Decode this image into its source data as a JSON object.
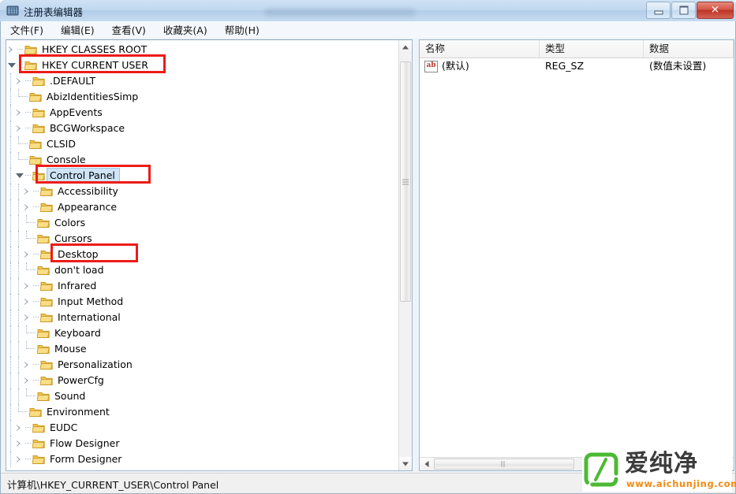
{
  "window": {
    "title": "注册表编辑器",
    "icon": "registry-editor-icon",
    "controls": {
      "minimize": "–",
      "maximize": "□",
      "close": "✕"
    }
  },
  "menubar": {
    "items": [
      {
        "label": "文件(F)",
        "name": "menu-file"
      },
      {
        "label": "编辑(E)",
        "name": "menu-edit"
      },
      {
        "label": "查看(V)",
        "name": "menu-view"
      },
      {
        "label": "收藏夹(A)",
        "name": "menu-favorites"
      },
      {
        "label": "帮助(H)",
        "name": "menu-help"
      }
    ]
  },
  "tree": {
    "items": [
      {
        "label": "HKEY CLASSES ROOT",
        "depth": 0,
        "state": "collapsed",
        "selected": false,
        "highlight": false
      },
      {
        "label": "HKEY CURRENT USER",
        "depth": 0,
        "state": "expanded",
        "selected": false,
        "highlight": true
      },
      {
        "label": ".DEFAULT",
        "depth": 1,
        "state": "collapsed",
        "selected": false,
        "highlight": false
      },
      {
        "label": "AbizIdentitiesSimp",
        "depth": 1,
        "state": "leaf",
        "selected": false,
        "highlight": false
      },
      {
        "label": "AppEvents",
        "depth": 1,
        "state": "collapsed",
        "selected": false,
        "highlight": false
      },
      {
        "label": "BCGWorkspace",
        "depth": 1,
        "state": "collapsed",
        "selected": false,
        "highlight": false
      },
      {
        "label": "CLSID",
        "depth": 1,
        "state": "leaf",
        "selected": false,
        "highlight": false
      },
      {
        "label": "Console",
        "depth": 1,
        "state": "leaf",
        "selected": false,
        "highlight": false
      },
      {
        "label": "Control Panel",
        "depth": 1,
        "state": "expanded",
        "selected": true,
        "highlight": true
      },
      {
        "label": "Accessibility",
        "depth": 2,
        "state": "collapsed",
        "selected": false,
        "highlight": false
      },
      {
        "label": "Appearance",
        "depth": 2,
        "state": "collapsed",
        "selected": false,
        "highlight": false
      },
      {
        "label": "Colors",
        "depth": 2,
        "state": "leaf",
        "selected": false,
        "highlight": false
      },
      {
        "label": "Cursors",
        "depth": 2,
        "state": "leaf",
        "selected": false,
        "highlight": false
      },
      {
        "label": "Desktop",
        "depth": 2,
        "state": "collapsed",
        "selected": false,
        "highlight": true
      },
      {
        "label": "don't load",
        "depth": 2,
        "state": "leaf",
        "selected": false,
        "highlight": false
      },
      {
        "label": "Infrared",
        "depth": 2,
        "state": "collapsed",
        "selected": false,
        "highlight": false
      },
      {
        "label": "Input Method",
        "depth": 2,
        "state": "collapsed",
        "selected": false,
        "highlight": false
      },
      {
        "label": "International",
        "depth": 2,
        "state": "collapsed",
        "selected": false,
        "highlight": false
      },
      {
        "label": "Keyboard",
        "depth": 2,
        "state": "leaf",
        "selected": false,
        "highlight": false
      },
      {
        "label": "Mouse",
        "depth": 2,
        "state": "leaf",
        "selected": false,
        "highlight": false
      },
      {
        "label": "Personalization",
        "depth": 2,
        "state": "collapsed",
        "selected": false,
        "highlight": false
      },
      {
        "label": "PowerCfg",
        "depth": 2,
        "state": "collapsed",
        "selected": false,
        "highlight": false
      },
      {
        "label": "Sound",
        "depth": 2,
        "state": "leaf",
        "selected": false,
        "highlight": false
      },
      {
        "label": "Environment",
        "depth": 1,
        "state": "leaf",
        "selected": false,
        "highlight": false
      },
      {
        "label": "EUDC",
        "depth": 1,
        "state": "collapsed",
        "selected": false,
        "highlight": false
      },
      {
        "label": "Flow Designer",
        "depth": 1,
        "state": "collapsed",
        "selected": false,
        "highlight": false
      },
      {
        "label": "Form Designer",
        "depth": 1,
        "state": "collapsed",
        "selected": false,
        "highlight": false
      }
    ]
  },
  "values": {
    "columns": [
      {
        "label": "名称",
        "name": "column-name"
      },
      {
        "label": "类型",
        "name": "column-type"
      },
      {
        "label": "数据",
        "name": "column-data"
      }
    ],
    "rows": [
      {
        "icon": "ab-string-icon",
        "icon_text": "ab",
        "name": "(默认)",
        "type": "REG_SZ",
        "data": "(数值未设置)"
      }
    ]
  },
  "statusbar": {
    "path": "计算机\\HKEY_CURRENT_USER\\Control Panel"
  },
  "watermark": {
    "brand": "爱纯净",
    "url": "www.aichunjing.com",
    "logo_color": "#4cba34",
    "url_color": "#f08a12"
  },
  "colors": {
    "annotation_red": "#ec1c17",
    "selection_blue": "#cfe4f7",
    "titlebar_blue": "#bfd7ee"
  }
}
